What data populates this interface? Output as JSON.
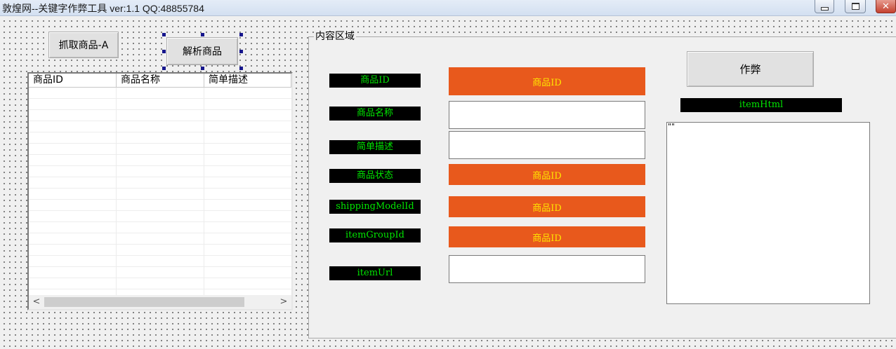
{
  "window": {
    "title": "敦煌网--关键字作弊工具 ver:1.1 QQ:48855784",
    "minimize_icon": "minimize-icon",
    "maximize_icon": "maximize-icon",
    "close_icon": "close-icon",
    "close_glyph": "✕"
  },
  "toolbar": {
    "grab_label": "抓取商品-A",
    "parse_label": "解析商品"
  },
  "product_list": {
    "columns": [
      "商品ID",
      "商品名称",
      "简单描述"
    ],
    "scroll_left": "<",
    "scroll_right": ">"
  },
  "content": {
    "group_title": "内容区域",
    "fields": [
      {
        "label": "商品ID",
        "value": "商品ID"
      },
      {
        "label": "商品名称",
        "value": ""
      },
      {
        "label": "简单描述",
        "value": ""
      },
      {
        "label": "商品状态",
        "value": "商品ID"
      },
      {
        "label": "shippingModelId",
        "value": "商品ID"
      },
      {
        "label": "itemGroupId",
        "value": "商品ID"
      },
      {
        "label": "itemUrl",
        "value": ""
      }
    ],
    "cheat_label": "作弊",
    "html_label": "itemHtml",
    "html_value": "\"\""
  },
  "colors": {
    "label_bg": "#000000",
    "label_text": "#00e600",
    "value_bg": "#e8591c",
    "value_text": "#ffe600"
  }
}
